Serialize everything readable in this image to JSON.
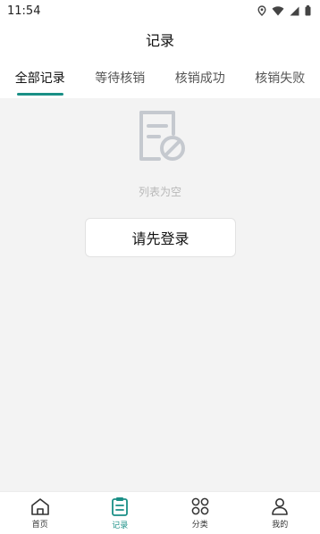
{
  "status_bar": {
    "time": "11:54",
    "icons": [
      "location-icon",
      "wifi-icon",
      "signal-icon",
      "battery-icon"
    ]
  },
  "app_bar": {
    "title": "记录"
  },
  "tabs": [
    {
      "label": "全部记录",
      "active": true
    },
    {
      "label": "等待核销",
      "active": false
    },
    {
      "label": "核销成功",
      "active": false
    },
    {
      "label": "核销失败",
      "active": false
    }
  ],
  "empty_state": {
    "icon": "empty-list-icon",
    "text": "列表为空",
    "login_button": "请先登录"
  },
  "bottom_nav": [
    {
      "label": "首页",
      "icon": "home-icon",
      "active": false
    },
    {
      "label": "记录",
      "icon": "record-icon",
      "active": true
    },
    {
      "label": "分类",
      "icon": "category-icon",
      "active": false
    },
    {
      "label": "我的",
      "icon": "profile-icon",
      "active": false
    }
  ],
  "colors": {
    "accent": "#1a8f86",
    "background": "#f3f3f3",
    "surface": "#ffffff",
    "empty_icon": "#c5c9cf",
    "empty_text": "#b8b8b8"
  }
}
